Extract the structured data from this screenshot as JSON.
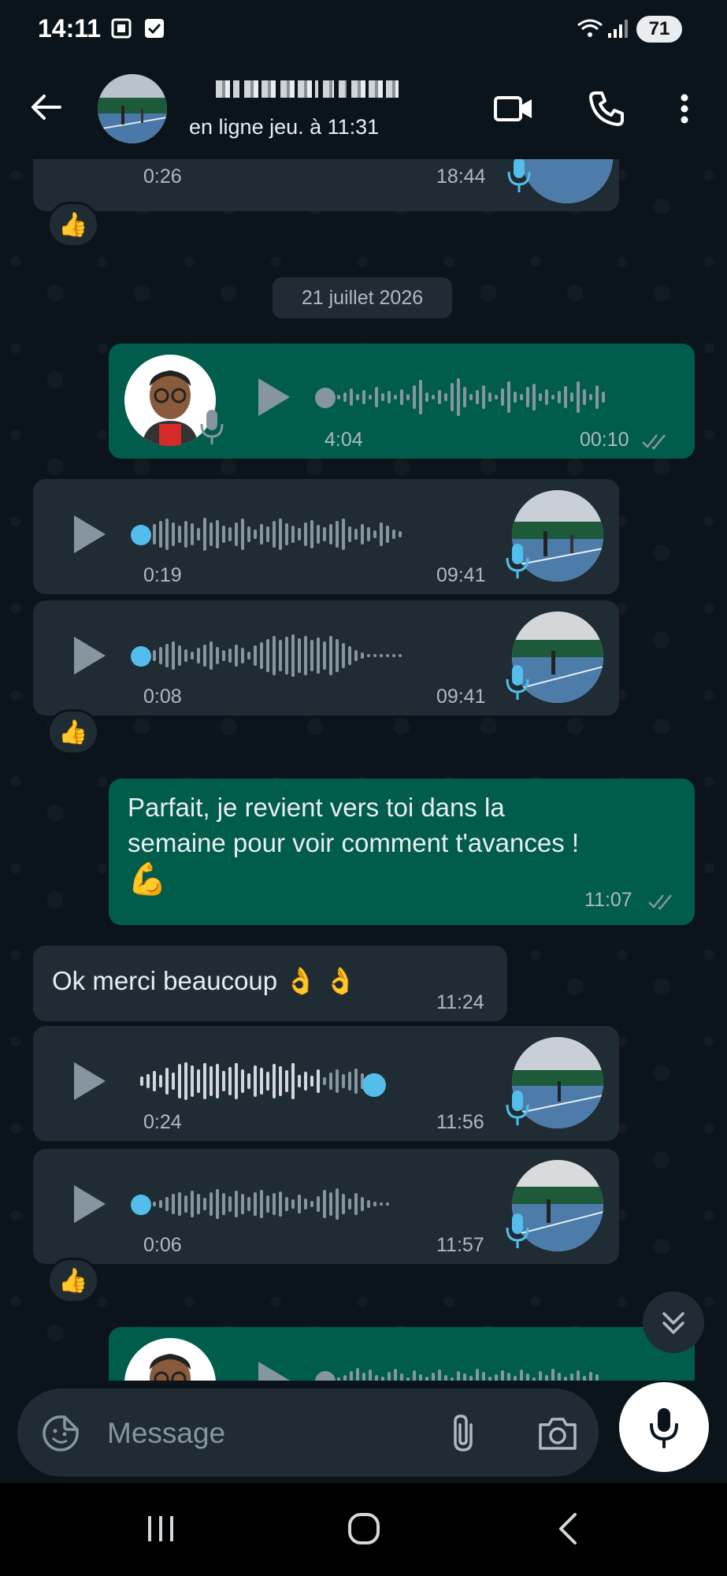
{
  "status_bar": {
    "time": "14:11",
    "battery": "71"
  },
  "header": {
    "contact_name": "",
    "status": "en ligne jeu. à 11:31"
  },
  "chat": {
    "date_chip": "21 juillet 2026",
    "messages": [
      {
        "id": "m0",
        "type": "voice",
        "direction": "in",
        "duration": "0:26",
        "time": "18:44",
        "reaction": "👍"
      },
      {
        "id": "m1",
        "type": "voice",
        "direction": "out",
        "duration": "4:04",
        "time": "00:10",
        "played": true
      },
      {
        "id": "m2",
        "type": "voice",
        "direction": "in",
        "duration": "0:19",
        "time": "09:41"
      },
      {
        "id": "m3",
        "type": "voice",
        "direction": "in",
        "duration": "0:08",
        "time": "09:41",
        "reaction": "👍"
      },
      {
        "id": "m4",
        "type": "text",
        "direction": "out",
        "text_line1": "Parfait, je revient vers toi dans la",
        "text_line2": "semaine pour voir comment t'avances !",
        "emoji": "💪",
        "time": "11:07"
      },
      {
        "id": "m5",
        "type": "text",
        "direction": "in",
        "text": "Ok merci beaucoup 👌 👌",
        "time": "11:24"
      },
      {
        "id": "m6",
        "type": "voice",
        "direction": "in",
        "duration": "0:24",
        "time": "11:56",
        "progress": 0.68
      },
      {
        "id": "m7",
        "type": "voice",
        "direction": "in",
        "duration": "0:06",
        "time": "11:57",
        "reaction": "👍"
      },
      {
        "id": "m8",
        "type": "voice",
        "direction": "out"
      }
    ]
  },
  "composer": {
    "placeholder": "Message"
  },
  "colors": {
    "incoming": "#202c33",
    "outgoing": "#005c4b",
    "accent_blue": "#53bdeb",
    "background": "#0b141a"
  },
  "icons": [
    "back-arrow-icon",
    "video-call-icon",
    "phone-icon",
    "more-options-icon",
    "play-icon",
    "mic-icon",
    "read-ticks-icon",
    "sticker-icon",
    "attach-icon",
    "camera-icon",
    "scroll-down-icon",
    "recent-apps-icon",
    "home-icon",
    "nav-back-icon"
  ]
}
